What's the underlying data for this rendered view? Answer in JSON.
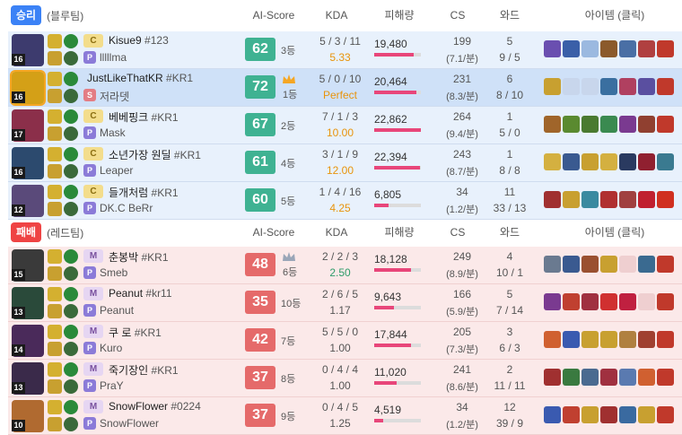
{
  "columns": {
    "ai_score": "AI-Score",
    "kda": "KDA",
    "damage": "피해량",
    "cs": "CS",
    "ward": "와드",
    "items": "아이템 (클릭)"
  },
  "blue_team": {
    "result": "승리",
    "name": "(블루팀)",
    "players": [
      {
        "level": "16",
        "rank_tag": "C",
        "summoner": "Kisue9",
        "tag": "#123",
        "sub_tag": "P",
        "sub_name": "lllllma",
        "score": "62",
        "rank": "3등",
        "kda": "5 / 3 / 11",
        "kda_ratio": "5.33",
        "kda_color": "orange",
        "damage": "19,480",
        "damage_frac": 0.85,
        "cs": "199",
        "cs_min": "(7.1/분)",
        "wards": "5",
        "wards_detail": "9 / 5",
        "champ_color": "#3d3b6e",
        "items": [
          "#6a4fb0",
          "#3a5fa8",
          "#9bb9e0",
          "#8b5a2b",
          "#4a6fa5",
          "#b04040",
          "#c0392b"
        ]
      },
      {
        "level": "16",
        "rank_tag": "",
        "summoner": "JustLikeThatKR",
        "tag": "#KR1",
        "sub_tag": "S",
        "sub_name": "저라뎃",
        "score": "72",
        "rank": "1등",
        "kda": "5 / 0 / 10",
        "kda_ratio": "Perfect",
        "kda_color": "orange",
        "damage": "20,464",
        "damage_frac": 0.9,
        "cs": "231",
        "cs_min": "(8.3/분)",
        "wards": "6",
        "wards_detail": "8 / 10",
        "champ_color": "#d4a017",
        "crown": "gold",
        "items": [
          "#c8a030",
          "",
          "",
          "#3a6fa0",
          "#b04060",
          "#5a4fa0",
          "#c0392b"
        ]
      },
      {
        "level": "17",
        "rank_tag": "C",
        "summoner": "베베핑크",
        "tag": "#KR1",
        "sub_tag": "P",
        "sub_name": "Mask",
        "score": "67",
        "rank": "2등",
        "kda": "7 / 1 / 3",
        "kda_ratio": "10.00",
        "kda_color": "orange",
        "damage": "22,862",
        "damage_frac": 1.0,
        "cs": "264",
        "cs_min": "(9.4/분)",
        "wards": "1",
        "wards_detail": "5 / 0",
        "champ_color": "#8b2f4a",
        "items": [
          "#a0652a",
          "#5a8a30",
          "#4a7a30",
          "#3a8a50",
          "#7a3a90",
          "#904030",
          "#c0392b"
        ]
      },
      {
        "level": "16",
        "rank_tag": "C",
        "summoner": "소년가장 원딜",
        "tag": "#KR1",
        "sub_tag": "P",
        "sub_name": "Leaper",
        "score": "61",
        "rank": "4등",
        "kda": "3 / 1 / 9",
        "kda_ratio": "12.00",
        "kda_color": "orange",
        "damage": "22,394",
        "damage_frac": 0.98,
        "cs": "243",
        "cs_min": "(8.7/분)",
        "wards": "1",
        "wards_detail": "8 / 8",
        "champ_color": "#2c4a6e",
        "items": [
          "#d4b040",
          "#3a5a90",
          "#c8a030",
          "#d4b040",
          "#2a3a60",
          "#902030",
          "#3a7a90"
        ]
      },
      {
        "level": "12",
        "rank_tag": "C",
        "summoner": "들개처럼",
        "tag": "#KR1",
        "sub_tag": "P",
        "sub_name": "DK.C BeRr",
        "score": "60",
        "rank": "5등",
        "kda": "1 / 4 / 16",
        "kda_ratio": "4.25",
        "kda_color": "orange",
        "damage": "6,805",
        "damage_frac": 0.3,
        "cs": "34",
        "cs_min": "(1.2/분)",
        "wards": "11",
        "wards_detail": "33 / 13",
        "champ_color": "#5a4a7a",
        "items": [
          "#a03030",
          "#c8a030",
          "#3a8aa0",
          "#b03030",
          "#a04040",
          "#c02030",
          "#d03020"
        ]
      }
    ]
  },
  "red_team": {
    "result": "패배",
    "name": "(레드팀)",
    "players": [
      {
        "level": "15",
        "rank_tag": "M",
        "summoner": "춘봉박",
        "tag": "#KR1",
        "sub_tag": "P",
        "sub_name": "Smeb",
        "score": "48",
        "rank": "6등",
        "kda": "2 / 2 / 3",
        "kda_ratio": "2.50",
        "kda_color": "green",
        "damage": "18,128",
        "damage_frac": 0.79,
        "cs": "249",
        "cs_min": "(8.9/분)",
        "wards": "4",
        "wards_detail": "10 / 1",
        "champ_color": "#3a3a3a",
        "crown": "silver",
        "items": [
          "#6a7a90",
          "#3a5a90",
          "#9a5030",
          "#c8a030",
          "",
          "#3a6a90",
          "#c0392b"
        ]
      },
      {
        "level": "13",
        "rank_tag": "M",
        "summoner": "Peanut",
        "tag": "#kr11",
        "sub_tag": "P",
        "sub_name": "Peanut",
        "score": "35",
        "rank": "10등",
        "kda": "2 / 6 / 5",
        "kda_ratio": "1.17",
        "kda_color": "gray",
        "damage": "9,643",
        "damage_frac": 0.42,
        "cs": "166",
        "cs_min": "(5.9/분)",
        "wards": "5",
        "wards_detail": "7 / 14",
        "champ_color": "#2a4a3a",
        "items": [
          "#7a3a90",
          "#c04030",
          "#a03040",
          "#d03030",
          "#c02040",
          "",
          "#c0392b"
        ]
      },
      {
        "level": "14",
        "rank_tag": "M",
        "summoner": "쿠 로",
        "tag": "#KR1",
        "sub_tag": "P",
        "sub_name": "Kuro",
        "score": "42",
        "rank": "7등",
        "kda": "5 / 5 / 0",
        "kda_ratio": "1.00",
        "kda_color": "gray",
        "damage": "17,844",
        "damage_frac": 0.78,
        "cs": "205",
        "cs_min": "(7.3/분)",
        "wards": "3",
        "wards_detail": "6 / 3",
        "champ_color": "#4a2a5a",
        "items": [
          "#d06030",
          "#3a5ab0",
          "#c8a030",
          "#c8a030",
          "#b08040",
          "#a04030",
          "#c0392b"
        ]
      },
      {
        "level": "13",
        "rank_tag": "M",
        "summoner": "죽기장인",
        "tag": "#KR1",
        "sub_tag": "P",
        "sub_name": "PraY",
        "score": "37",
        "rank": "8등",
        "kda": "0 / 4 / 4",
        "kda_ratio": "1.00",
        "kda_color": "gray",
        "damage": "11,020",
        "damage_frac": 0.48,
        "cs": "241",
        "cs_min": "(8.6/분)",
        "wards": "2",
        "wards_detail": "11 / 11",
        "champ_color": "#3a2a4a",
        "items": [
          "#a03030",
          "#3a7a40",
          "#4a6a90",
          "#a03040",
          "#5a7ab0",
          "#d06030",
          "#c0392b"
        ]
      },
      {
        "level": "10",
        "rank_tag": "M",
        "summoner": "SnowFlower",
        "tag": "#0224",
        "sub_tag": "P",
        "sub_name": "SnowFlower",
        "score": "37",
        "rank": "9등",
        "kda": "0 / 4 / 5",
        "kda_ratio": "1.25",
        "kda_color": "gray",
        "damage": "4,519",
        "damage_frac": 0.2,
        "cs": "34",
        "cs_min": "(1.2/분)",
        "wards": "12",
        "wards_detail": "39 / 9",
        "champ_color": "#b06a30",
        "items": [
          "#3a5ab0",
          "#c04030",
          "#c8a030",
          "#a03030",
          "#3a6aa0",
          "#c8a030",
          "#c0392b"
        ]
      }
    ]
  }
}
